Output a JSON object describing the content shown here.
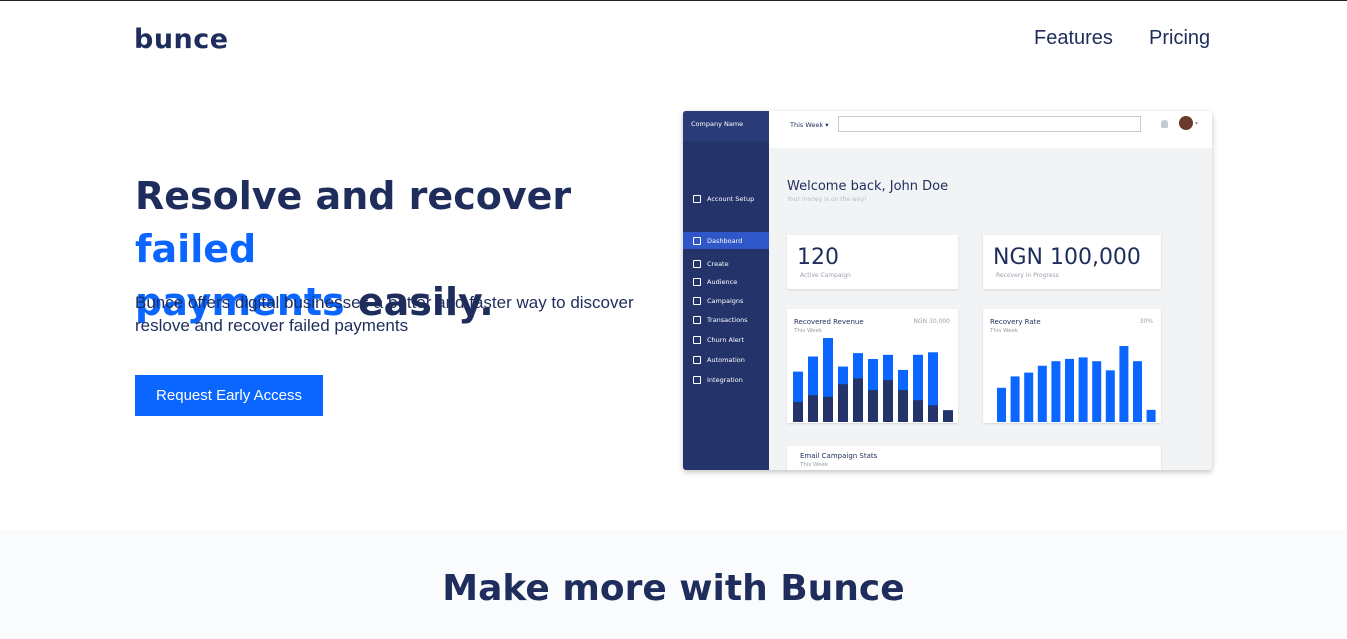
{
  "nav": {
    "logo": "bunce",
    "features": "Features",
    "pricing": "Pricing"
  },
  "hero": {
    "title_part1": "Resolve and recover ",
    "title_accent1": "failed",
    "title_accent2": "payments",
    "title_part2": " easily.",
    "subtitle": "Bunce offers digital businesses a better and faster way to discover reslove and recover failed payments",
    "cta": "Request Early Access"
  },
  "mockup": {
    "company": "Company Name",
    "week": "This Week",
    "sidebar": [
      {
        "label": "Account Setup",
        "icon": "setup-icon"
      },
      {
        "label": "Dashboard",
        "icon": "dashboard-icon"
      },
      {
        "label": "Create",
        "icon": "edit-icon"
      },
      {
        "label": "Audience",
        "icon": "user-icon"
      },
      {
        "label": "Campaigns",
        "icon": "megaphone-icon"
      },
      {
        "label": "Transactions",
        "icon": "card-icon"
      },
      {
        "label": "Churn Alert",
        "icon": "pie-icon"
      },
      {
        "label": "Automation",
        "icon": "infinity-icon"
      },
      {
        "label": "Integration",
        "icon": "plug-icon"
      }
    ],
    "welcome": "Welcome back, John Doe",
    "welcome_sub": "Your money is on the way!",
    "stat1_value": "120",
    "stat1_label": "Active Campaign",
    "stat2_value": "NGN 100,000",
    "stat2_label": "Recovery in Progress",
    "revenue_title": "Recovered Revenue",
    "revenue_sub": "This Week",
    "revenue_value": "NGN 30,000",
    "rate_title": "Recovery Rate",
    "rate_sub": "This Week",
    "rate_value": "30%",
    "email_title": "Email Campaign Stats",
    "email_sub": "This Week",
    "colors": {
      "light_bar": "#0a66ff",
      "dark_bar": "#24346b",
      "sidebar": "#24346b"
    }
  },
  "chart_data": [
    {
      "type": "bar",
      "title": "Recovered Revenue",
      "stacked": true,
      "series": [
        {
          "values": [
            0.6,
            0.78,
            1.0,
            0.66,
            0.82,
            0.75,
            0.8,
            0.62,
            0.8,
            0.83,
            0.14
          ]
        },
        {
          "values": [
            0.24,
            0.32,
            0.3,
            0.45,
            0.52,
            0.38,
            0.5,
            0.38,
            0.26,
            0.2,
            0.14
          ]
        }
      ]
    },
    {
      "type": "bar",
      "title": "Recovery Rate",
      "values": [
        0.45,
        0.6,
        0.65,
        0.74,
        0.8,
        0.83,
        0.85,
        0.8,
        0.68,
        1.0,
        0.8,
        0.16
      ]
    }
  ],
  "section2": {
    "title": "Make more with Bunce",
    "cut_text": "... ... ... ... ..."
  }
}
